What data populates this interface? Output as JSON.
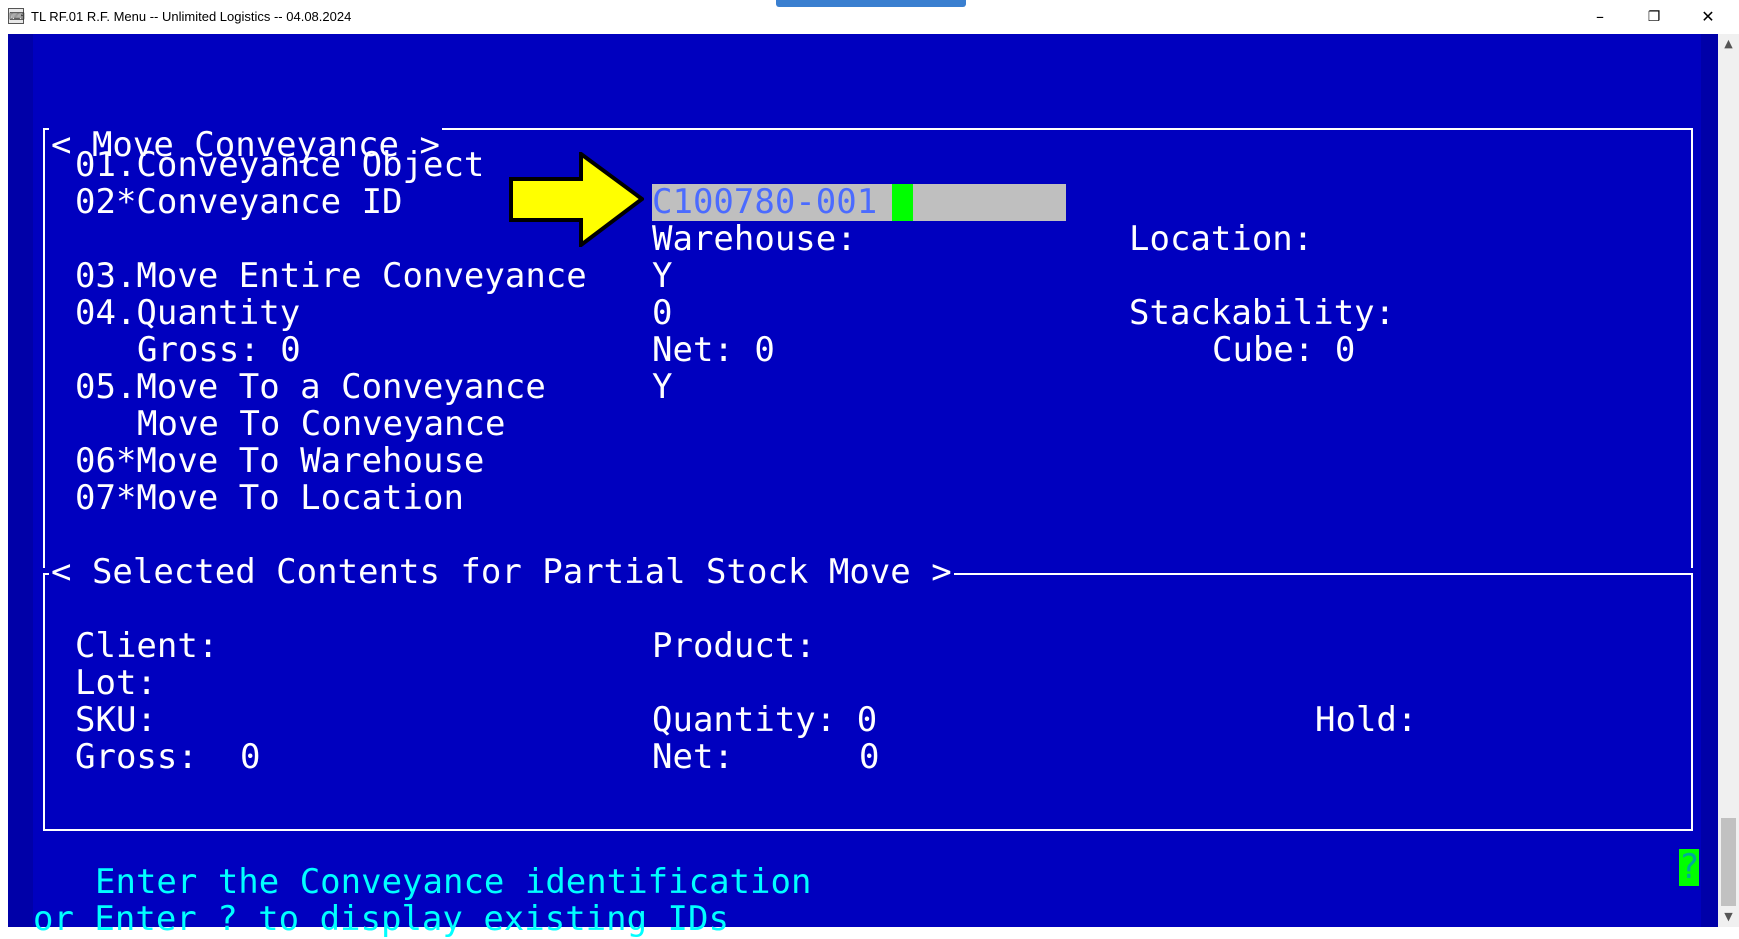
{
  "window": {
    "title": "TL RF.01 R.F. Menu -- Unlimited Logistics -- 04.08.2024",
    "minimize_icon": "minimize-icon",
    "restore_icon": "restore-icon",
    "close_icon": "close-icon",
    "minimize_glyph": "–",
    "restore_glyph": "❐",
    "close_glyph": "✕"
  },
  "sections": {
    "move_conveyance": "< Move Conveyance >",
    "selected_contents": "< Selected Contents for Partial Stock Move >"
  },
  "fields": {
    "f01": "01.Conveyance Object",
    "f02": "02*Conveyance ID",
    "f02_value": "C100780-001",
    "warehouse_label": "Warehouse:",
    "location_label": "Location:",
    "f03": "03.Move Entire Conveyance",
    "f03_value": "Y",
    "f04": "04.Quantity",
    "f04_value": "0",
    "stackability_label": "Stackability:",
    "gross": "Gross: 0",
    "net": "Net: 0",
    "cube": "Cube: 0",
    "f05": "05.Move To a Conveyance",
    "f05_value": "Y",
    "move_to_conveyance": "Move To Conveyance",
    "f06": "06*Move To Warehouse",
    "f07": "07*Move To Location"
  },
  "contents": {
    "client_label": "Client:",
    "product_label": "Product:",
    "lot_label": "Lot:",
    "sku_label": "SKU:",
    "quantity": "Quantity: 0",
    "hold_label": "Hold:",
    "gross_label": "Gross:",
    "gross_value": "0",
    "net_label": "Net:",
    "net_value": "0"
  },
  "prompt": {
    "line1": "Enter the Conveyance identification",
    "line2": "or Enter ? to display existing IDs",
    "help_char": "?"
  },
  "colors": {
    "terminal_bg": "#0000bf",
    "field_bg": "#bfbfbf",
    "cursor": "#00ff00",
    "prompt_text": "#00ffff",
    "arrow_fill": "#ffff00"
  }
}
